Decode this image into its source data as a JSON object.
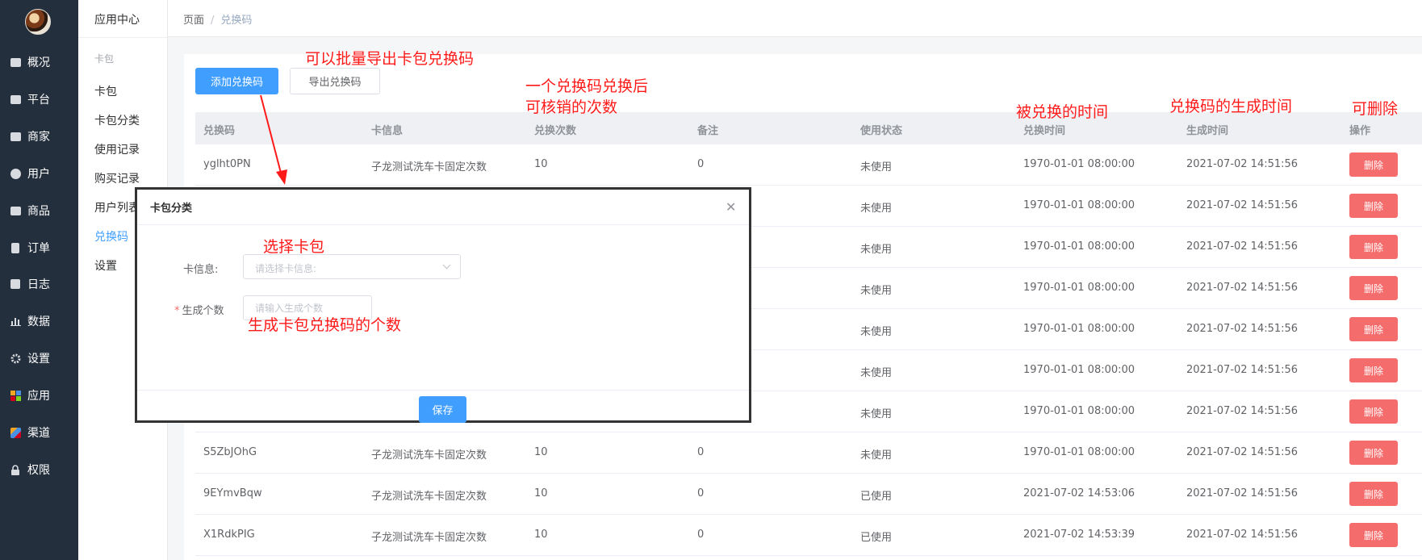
{
  "nav": {
    "items": [
      {
        "label": "概况",
        "icon": "dashboard-icon"
      },
      {
        "label": "平台",
        "icon": "monitor-icon"
      },
      {
        "label": "商家",
        "icon": "store-icon"
      },
      {
        "label": "用户",
        "icon": "user-icon"
      },
      {
        "label": "商品",
        "icon": "product-icon"
      },
      {
        "label": "订单",
        "icon": "order-icon"
      },
      {
        "label": "日志",
        "icon": "log-icon"
      },
      {
        "label": "数据",
        "icon": "chart-icon"
      },
      {
        "label": "设置",
        "icon": "gear-icon"
      },
      {
        "label": "应用",
        "icon": "apps-icon"
      },
      {
        "label": "渠道",
        "icon": "channel-cube-icon"
      },
      {
        "label": "权限",
        "icon": "lock-icon"
      }
    ]
  },
  "submenu": {
    "title": "应用中心",
    "group": "卡包",
    "items": [
      {
        "label": "卡包"
      },
      {
        "label": "卡包分类"
      },
      {
        "label": "使用记录"
      },
      {
        "label": "购买记录"
      },
      {
        "label": "用户列表"
      },
      {
        "label": "兑换码"
      },
      {
        "label": "设置"
      }
    ]
  },
  "breadcrumb": {
    "root": "页面",
    "separator": "/",
    "current": "兑换码"
  },
  "toolbar": {
    "add_label": "添加兑换码",
    "export_label": "导出兑换码"
  },
  "table": {
    "headers": [
      "兑换码",
      "卡信息",
      "兑换次数",
      "备注",
      "使用状态",
      "兑换时间",
      "生成时间",
      "操作"
    ],
    "delete_label": "删除",
    "rows": [
      {
        "code": "yglht0PN",
        "card": "子龙测试洗车卡固定次数",
        "times": "10",
        "remark": "0",
        "status": "未使用",
        "redeemed": "1970-01-01 08:00:00",
        "created": "2021-07-02 14:51:56"
      },
      {
        "code": "",
        "card": "",
        "times": "",
        "remark": "",
        "status": "未使用",
        "redeemed": "1970-01-01 08:00:00",
        "created": "2021-07-02 14:51:56"
      },
      {
        "code": "",
        "card": "",
        "times": "",
        "remark": "",
        "status": "未使用",
        "redeemed": "1970-01-01 08:00:00",
        "created": "2021-07-02 14:51:56"
      },
      {
        "code": "",
        "card": "",
        "times": "",
        "remark": "",
        "status": "未使用",
        "redeemed": "1970-01-01 08:00:00",
        "created": "2021-07-02 14:51:56"
      },
      {
        "code": "",
        "card": "",
        "times": "",
        "remark": "",
        "status": "未使用",
        "redeemed": "1970-01-01 08:00:00",
        "created": "2021-07-02 14:51:56"
      },
      {
        "code": "",
        "card": "",
        "times": "",
        "remark": "",
        "status": "未使用",
        "redeemed": "1970-01-01 08:00:00",
        "created": "2021-07-02 14:51:56"
      },
      {
        "code": "",
        "card": "",
        "times": "",
        "remark": "",
        "status": "未使用",
        "redeemed": "1970-01-01 08:00:00",
        "created": "2021-07-02 14:51:56"
      },
      {
        "code": "S5ZbJOhG",
        "card": "子龙测试洗车卡固定次数",
        "times": "10",
        "remark": "0",
        "status": "未使用",
        "redeemed": "1970-01-01 08:00:00",
        "created": "2021-07-02 14:51:56"
      },
      {
        "code": "9EYmvBqw",
        "card": "子龙测试洗车卡固定次数",
        "times": "10",
        "remark": "0",
        "status": "已使用",
        "redeemed": "2021-07-02 14:53:06",
        "created": "2021-07-02 14:51:56"
      },
      {
        "code": "X1RdkPIG",
        "card": "子龙测试洗车卡固定次数",
        "times": "10",
        "remark": "0",
        "status": "已使用",
        "redeemed": "2021-07-02 14:53:39",
        "created": "2021-07-02 14:51:56"
      }
    ]
  },
  "dialog": {
    "title": "卡包分类",
    "close_icon": "close-icon",
    "card_label": "卡信息:",
    "card_placeholder": "请选择卡信息:",
    "count_label": "生成个数",
    "count_required": "*",
    "count_placeholder": "请输入生成个数",
    "save_label": "保存"
  },
  "annotations": {
    "export_note": "可以批量导出卡包兑换码",
    "times_note_line1": "一个兑换码兑换后",
    "times_note_line2": "可核销的次数",
    "redeem_time_note": "被兑换的时间",
    "create_time_note": "兑换码的生成时间",
    "delete_note": "可删除",
    "select_card_note": "选择卡包",
    "count_note": "生成卡包兑换码的个数"
  },
  "colors": {
    "primary": "#409eff",
    "danger": "#f56c6c",
    "nav_bg": "#242f3d",
    "annotation": "#ff1a1a"
  }
}
